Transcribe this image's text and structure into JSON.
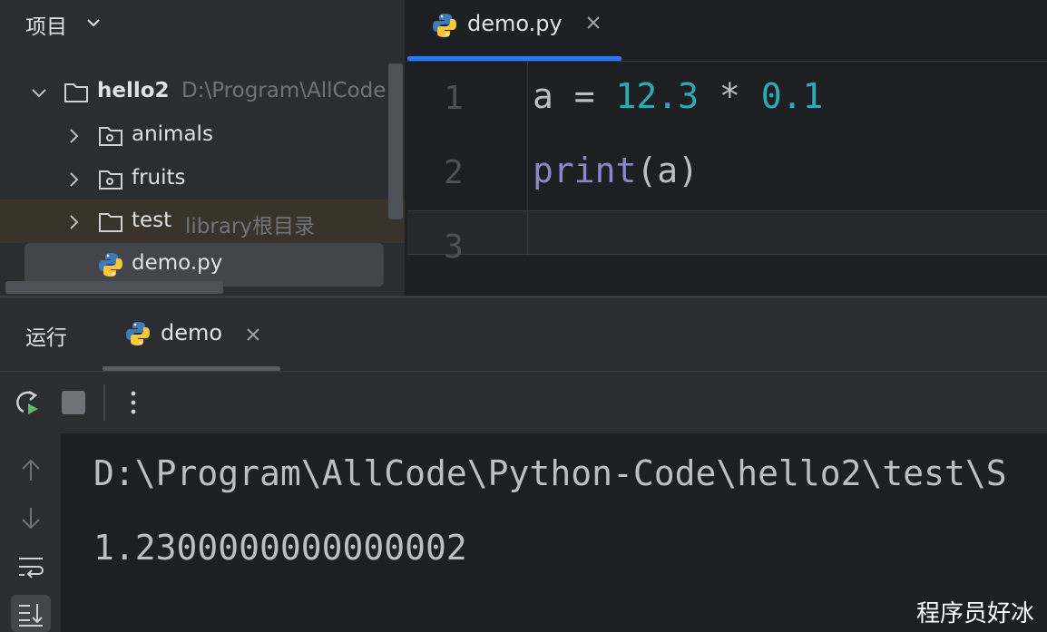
{
  "project_panel": {
    "title": "项目",
    "tree": [
      {
        "name": "hello2",
        "hint": "D:\\Program\\AllCode",
        "expanded": true
      },
      {
        "name": "animals"
      },
      {
        "name": "fruits"
      },
      {
        "name": "test",
        "hint": "library根目录"
      },
      {
        "name": "demo.py",
        "selected": true
      }
    ]
  },
  "editor": {
    "tab_label": "demo.py",
    "line_numbers": [
      "1",
      "2",
      "3"
    ],
    "code": [
      {
        "var": "a",
        "op1": " = ",
        "n1": "12.3",
        "op2": " * ",
        "n2": "0.1"
      },
      {
        "fn": "print",
        "args": "(a)"
      }
    ]
  },
  "run_panel": {
    "title": "运行",
    "tab_label": "demo",
    "output": [
      "D:\\Program\\AllCode\\Python-Code\\hello2\\test\\S",
      "1.2300000000000002"
    ]
  },
  "watermark": "程序员好冰",
  "colors": {
    "accent": "#3574f0",
    "number": "#2aacb8",
    "builtin": "#8888c6",
    "bg": "#1e1f22",
    "panel": "#2b2d30"
  }
}
